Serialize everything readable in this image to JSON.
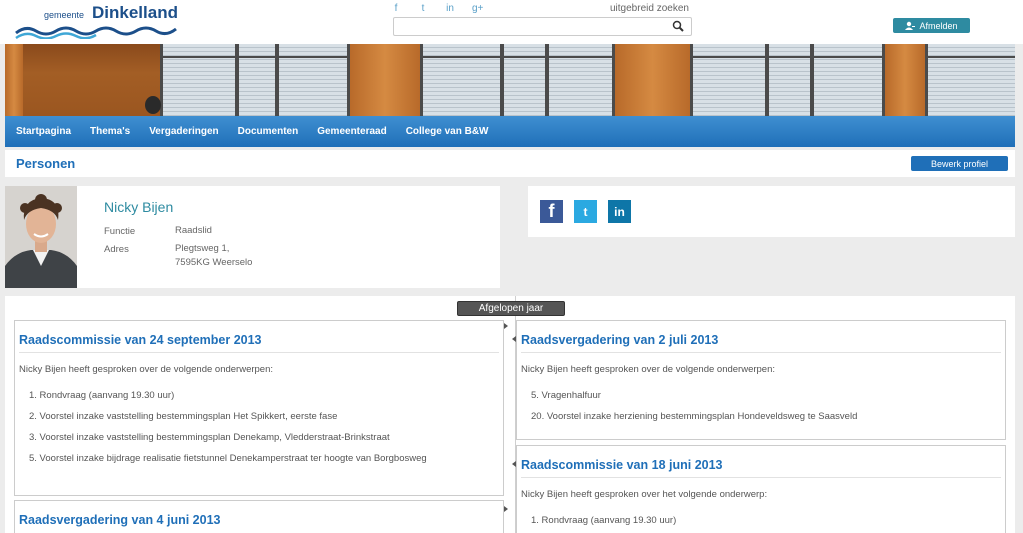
{
  "logo": {
    "small": "gemeente",
    "big": "Dinkelland"
  },
  "header": {
    "social": [
      "f",
      "t",
      "in",
      "g+"
    ],
    "advanced_search": "uitgebreid zoeken",
    "search_placeholder": "",
    "logout": "Afmelden"
  },
  "nav": [
    "Startpagina",
    "Thema's",
    "Vergaderingen",
    "Documenten",
    "Gemeenteraad",
    "College van B&W"
  ],
  "page": {
    "title": "Personen",
    "edit_profile": "Bewerk profiel"
  },
  "profile": {
    "name": "Nicky Bijen",
    "function_label": "Functie",
    "function_value": "Raadslid",
    "address_label": "Adres",
    "address_line1": "Plegtsweg 1,",
    "address_line2": "7595KG Weerselo"
  },
  "share": [
    "f",
    "t",
    "in"
  ],
  "timeline": {
    "period": "Afgelopen jaar",
    "cards": [
      {
        "title": "Raadscommissie van 24 september 2013",
        "intro": "Nicky Bijen heeft gesproken over de volgende onderwerpen:",
        "items": [
          "1. Rondvraag (aanvang 19.30 uur)",
          "2. Voorstel inzake vaststelling bestemmingsplan Het Spikkert, eerste fase",
          "3. Voorstel inzake vaststelling bestemmingsplan Denekamp, Vledderstraat-Brinkstraat",
          "5. Voorstel inzake bijdrage realisatie fietstunnel Denekamperstraat ter hoogte van Borgbosweg"
        ]
      },
      {
        "title": "Raadsvergadering van 2 juli 2013",
        "intro": "Nicky Bijen heeft gesproken over de volgende onderwerpen:",
        "items": [
          "5. Vragenhalfuur",
          "20. Voorstel inzake herziening bestemmingsplan Hondeveldsweg te Saasveld"
        ]
      },
      {
        "title": "Raadscommissie van 18 juni 2013",
        "intro": "Nicky Bijen heeft gesproken over het volgende onderwerp:",
        "items": [
          "1. Rondvraag (aanvang 19.30 uur)"
        ]
      },
      {
        "title": "Raadsvergadering van 4 juni 2013",
        "intro": "",
        "items": []
      }
    ]
  },
  "colors": {
    "brand_blue": "#1f6fb8",
    "teal": "#2e8ba1"
  }
}
